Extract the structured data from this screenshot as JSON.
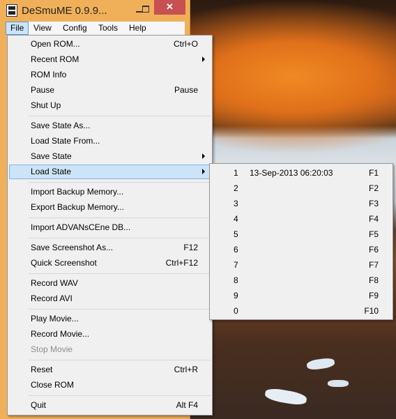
{
  "window": {
    "title": "DeSmuME 0.9.9...",
    "close_symbol": "✕"
  },
  "menubar": [
    "File",
    "View",
    "Config",
    "Tools",
    "Help"
  ],
  "file_menu": [
    {
      "label": "Open ROM...",
      "shortcut": "Ctrl+O"
    },
    {
      "label": "Recent ROM",
      "shortcut": "",
      "submenu": true
    },
    {
      "label": "ROM Info",
      "shortcut": ""
    },
    {
      "label": "Pause",
      "shortcut": "Pause"
    },
    {
      "label": "Shut Up",
      "shortcut": ""
    },
    {
      "label": "Save State As...",
      "shortcut": ""
    },
    {
      "label": "Load State From...",
      "shortcut": ""
    },
    {
      "label": "Save State",
      "shortcut": "",
      "submenu": true
    },
    {
      "label": "Load State",
      "shortcut": "",
      "submenu": true,
      "highlighted": true
    },
    {
      "label": "Import Backup Memory...",
      "shortcut": ""
    },
    {
      "label": "Export Backup Memory...",
      "shortcut": ""
    },
    {
      "label": "Import ADVANsCEne DB...",
      "shortcut": ""
    },
    {
      "label": "Save Screenshot As...",
      "shortcut": "F12"
    },
    {
      "label": "Quick Screenshot",
      "shortcut": "Ctrl+F12"
    },
    {
      "label": "Record WAV",
      "shortcut": ""
    },
    {
      "label": "Record AVI",
      "shortcut": ""
    },
    {
      "label": "Play Movie...",
      "shortcut": ""
    },
    {
      "label": "Record Movie...",
      "shortcut": ""
    },
    {
      "label": "Stop Movie",
      "shortcut": "",
      "disabled": true
    },
    {
      "label": "Reset",
      "shortcut": "Ctrl+R"
    },
    {
      "label": "Close ROM",
      "shortcut": ""
    },
    {
      "label": "Quit",
      "shortcut": "Alt F4"
    }
  ],
  "load_state_submenu": [
    {
      "slot": "1",
      "date": "13-Sep-2013 06:20:03",
      "key": "F1"
    },
    {
      "slot": "2",
      "date": "",
      "key": "F2"
    },
    {
      "slot": "3",
      "date": "",
      "key": "F3"
    },
    {
      "slot": "4",
      "date": "",
      "key": "F4"
    },
    {
      "slot": "5",
      "date": "",
      "key": "F5"
    },
    {
      "slot": "6",
      "date": "",
      "key": "F6"
    },
    {
      "slot": "7",
      "date": "",
      "key": "F7"
    },
    {
      "slot": "8",
      "date": "",
      "key": "F8"
    },
    {
      "slot": "9",
      "date": "",
      "key": "F9"
    },
    {
      "slot": "0",
      "date": "",
      "key": "F10"
    }
  ]
}
